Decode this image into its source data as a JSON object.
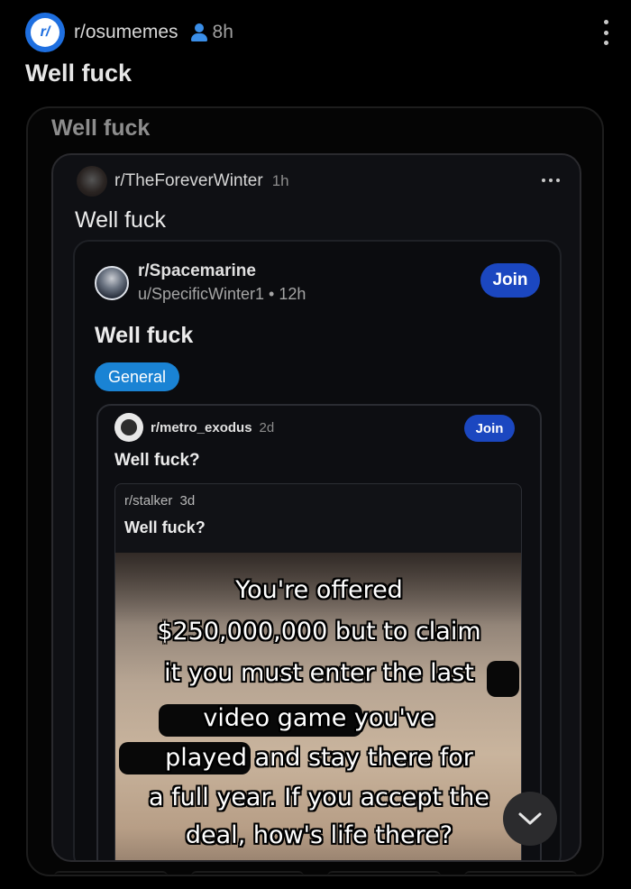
{
  "post": {
    "subreddit": "r/osumemes",
    "time": "8h",
    "title": "Well fuck",
    "avatar_glyph": "r/"
  },
  "crosspost1": {
    "title": "Well fuck"
  },
  "crosspost2": {
    "subreddit": "r/TheForeverWinter",
    "time": "1h",
    "title": "Well fuck"
  },
  "crosspost3": {
    "subreddit": "r/Spacemarine",
    "user_time": "u/SpecificWinter1 • 12h",
    "join_label": "Join",
    "title": "Well fuck",
    "flair": "General"
  },
  "crosspost4": {
    "subreddit": "r/metro_exodus",
    "time": "2d",
    "join_label": "Join",
    "title": "Well fuck?"
  },
  "crosspost5": {
    "subreddit": "r/stalker",
    "time": "3d",
    "title": "Well fuck?"
  },
  "meme": {
    "lines": [
      "You're offered",
      "$250,000,000 but to claim",
      "it you must enter the last",
      "video game        you've",
      "played        and stay there for",
      "a full year. If you accept the",
      "deal, how's life there?"
    ]
  },
  "colors": {
    "accent": "#1b47c0",
    "flair": "#1a83d4",
    "background": "#000000"
  },
  "icons": {
    "user": "user-icon",
    "more": "more-vertical-icon",
    "scroll": "chevron-down-icon"
  }
}
